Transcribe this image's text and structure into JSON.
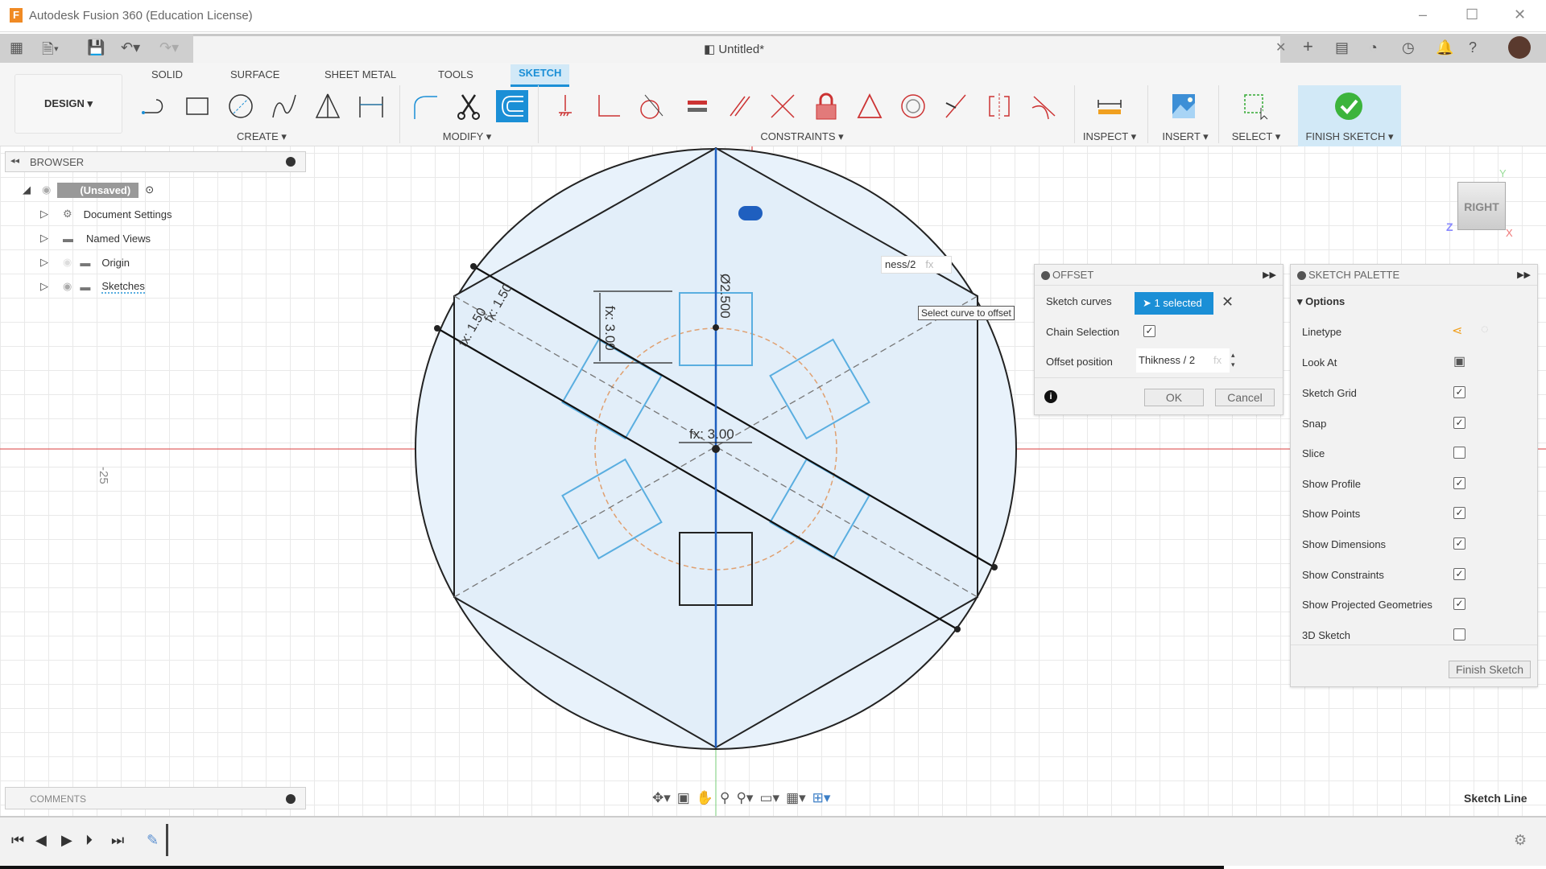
{
  "app": {
    "title": "Autodesk Fusion 360 (Education License)",
    "document_tab": "Untitled*"
  },
  "ribbon": {
    "tabs": [
      {
        "label": "SOLID"
      },
      {
        "label": "SURFACE"
      },
      {
        "label": "SHEET METAL"
      },
      {
        "label": "TOOLS"
      },
      {
        "label": "SKETCH",
        "active": true
      }
    ],
    "workspace": "DESIGN ▾",
    "groups": {
      "create": "CREATE ▾",
      "modify": "MODIFY ▾",
      "constraints": "CONSTRAINTS ▾",
      "inspect": "INSPECT ▾",
      "insert": "INSERT ▾",
      "select": "SELECT ▾",
      "finish": "FINISH SKETCH ▾"
    }
  },
  "browser": {
    "title": "BROWSER",
    "root": "(Unsaved)",
    "items": [
      {
        "label": "Document Settings",
        "icon": "gear-icon"
      },
      {
        "label": "Named Views",
        "icon": "folder-icon"
      },
      {
        "label": "Origin",
        "icon": "folder-icon"
      },
      {
        "label": "Sketches",
        "icon": "folder-icon"
      }
    ]
  },
  "comments": {
    "title": "COMMENTS"
  },
  "viewcube": {
    "face": "RIGHT",
    "axes": {
      "x": "X",
      "y": "Y",
      "z": "Z"
    }
  },
  "canvas": {
    "ruler_label": "-25",
    "dimensions": {
      "d1": "fx: 1.50",
      "d2": "fx: 1.50",
      "d3": "fx: 3.00",
      "d4": "Ø2.500",
      "d5": "fx: 3.00"
    },
    "inline_input": "ness/2",
    "inline_fx": "fx",
    "tooltip": "Select curve to offset",
    "colors": {
      "axis_red": "#e06666",
      "axis_blue": "#1f5fbf",
      "profile_fill": "#e8f2fb",
      "construction": "#e0a070",
      "offset_curve": "#5aaee0"
    }
  },
  "offset": {
    "title": "OFFSET",
    "sketch_curves_label": "Sketch curves",
    "selected": "1 selected",
    "chain_label": "Chain Selection",
    "chain_checked": true,
    "position_label": "Offset position",
    "position_value": "Thikness / 2",
    "fx": "fx",
    "ok": "OK",
    "cancel": "Cancel"
  },
  "palette": {
    "title": "SKETCH PALETTE",
    "section": "Options",
    "linetype": "Linetype",
    "look_at": "Look At",
    "options": [
      {
        "label": "Sketch Grid",
        "checked": true
      },
      {
        "label": "Snap",
        "checked": true
      },
      {
        "label": "Slice",
        "checked": false
      },
      {
        "label": "Show Profile",
        "checked": true
      },
      {
        "label": "Show Points",
        "checked": true
      },
      {
        "label": "Show Dimensions",
        "checked": true
      },
      {
        "label": "Show Constraints",
        "checked": true
      },
      {
        "label": "Show Projected Geometries",
        "checked": true
      },
      {
        "label": "3D Sketch",
        "checked": false
      }
    ],
    "finish": "Finish Sketch"
  },
  "status": {
    "text": "Sketch Line"
  }
}
